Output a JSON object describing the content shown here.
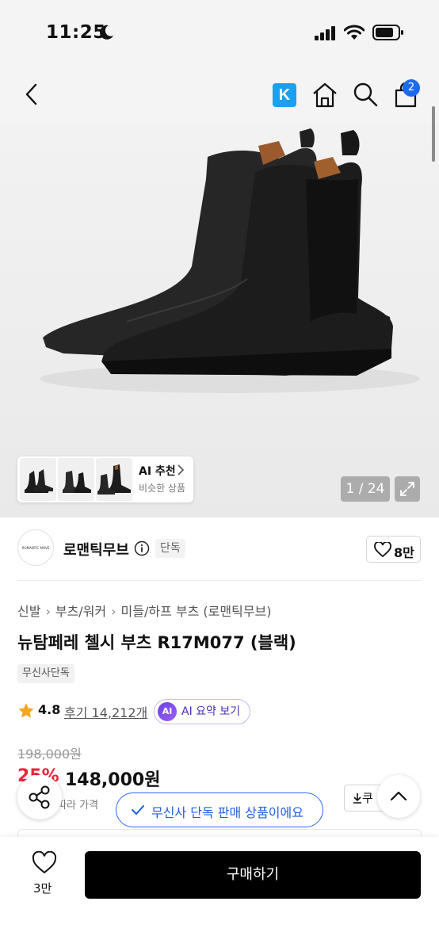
{
  "status_bar": {
    "time": "11:25"
  },
  "nav": {
    "store_badge": "K",
    "cart_count": "2"
  },
  "gallery": {
    "ai_recommend_title": "AI 추천",
    "ai_recommend_sub": "비슷한 상품",
    "counter": "1 / 24"
  },
  "brand": {
    "logo_text": "ROMANTIC MOVE",
    "name": "로맨틱무브",
    "tag": "단독",
    "like_count": "8만"
  },
  "breadcrumb": [
    "신발",
    "부츠/워커",
    "미들/하프 부츠 (로맨틱무브)"
  ],
  "product": {
    "title": "뉴탐페레 첼시 부츠 R17M077 (블랙)",
    "exclusive_tag": "무신사단독",
    "rating": "4.8",
    "reviews": "후기 14,212개",
    "ai_summary_icon": "AI",
    "ai_summary_label": "AI 요약 보기"
  },
  "price": {
    "original": "198,000원",
    "discount": "25%",
    "sale": "148,000원",
    "note": "에 따라 가격",
    "coupon": "쿠"
  },
  "toast": {
    "text": "무신사 단독 판매 상품이에요"
  },
  "bottom": {
    "like_count": "3만",
    "buy_label": "구매하기"
  },
  "colors": {
    "accent_blue": "#1d6af2",
    "discount_red": "#f0233c",
    "ai_purple": "#6a45e6",
    "kakao_blue": "#1aa0ef"
  },
  "icons": [
    "moon-icon",
    "signal-icon",
    "wifi-icon",
    "battery-icon",
    "back-icon",
    "home-icon",
    "search-icon",
    "bag-icon",
    "expand-icon",
    "info-icon",
    "heart-icon",
    "star-icon",
    "share-icon",
    "chevron-up-icon",
    "download-icon",
    "check-icon"
  ]
}
